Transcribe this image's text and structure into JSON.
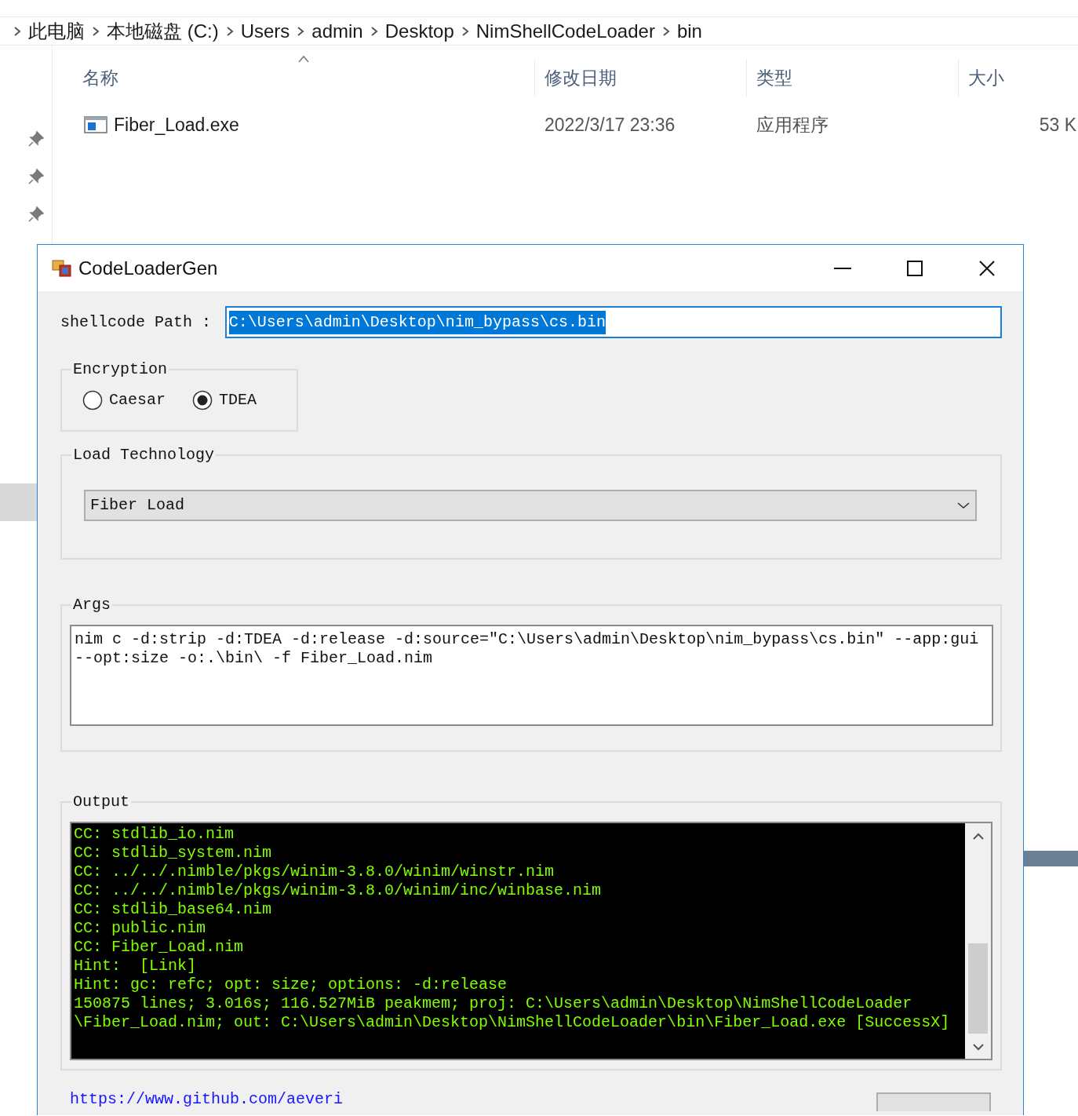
{
  "explorer": {
    "breadcrumb": [
      "此电脑",
      "本地磁盘 (C:)",
      "Users",
      "admin",
      "Desktop",
      "NimShellCodeLoader",
      "bin"
    ],
    "columns": [
      {
        "label": "名称",
        "sorted": true
      },
      {
        "label": "修改日期",
        "sorted": false
      },
      {
        "label": "类型",
        "sorted": false
      },
      {
        "label": "大小",
        "sorted": false
      }
    ],
    "files": [
      {
        "name": "Fiber_Load.exe",
        "modified": "2022/3/17 23:36",
        "type": "应用程序",
        "size": "53 K"
      }
    ]
  },
  "dialog": {
    "title": "CodeLoaderGen",
    "path": {
      "label": "shellcode Path :",
      "value": "C:\\Users\\admin\\Desktop\\nim_bypass\\cs.bin",
      "selected": true
    },
    "encryption": {
      "title": "Encryption",
      "options": [
        {
          "label": "Caesar",
          "selected": false
        },
        {
          "label": "TDEA",
          "selected": true
        }
      ]
    },
    "load_technology": {
      "title": "Load Technology",
      "value": "Fiber Load"
    },
    "args": {
      "title": "Args",
      "text": "nim c -d:strip -d:TDEA -d:release -d:source=\"C:\\Users\\admin\\Desktop\\nim_bypass\\cs.bin\" --app:gui --opt:size -o:.\\bin\\ -f Fiber_Load.nim"
    },
    "output": {
      "title": "Output",
      "lines": [
        "CC: stdlib_io.nim",
        "CC: stdlib_system.nim",
        "CC: ../../.nimble/pkgs/winim-3.8.0/winim/winstr.nim",
        "CC: ../../.nimble/pkgs/winim-3.8.0/winim/inc/winbase.nim",
        "CC: stdlib_base64.nim",
        "CC: public.nim",
        "CC: Fiber_Load.nim",
        "Hint:  [Link]",
        "Hint: gc: refc; opt: size; options: -d:release",
        "150875 lines; 3.016s; 116.527MiB peakmem; proj: C:\\Users\\admin\\Desktop\\NimShellCodeLoader",
        "\\Fiber_Load.nim; out: C:\\Users\\admin\\Desktop\\NimShellCodeLoader\\bin\\Fiber_Load.exe [SuccessX]"
      ]
    },
    "link": "https://www.github.com/aeveri"
  }
}
